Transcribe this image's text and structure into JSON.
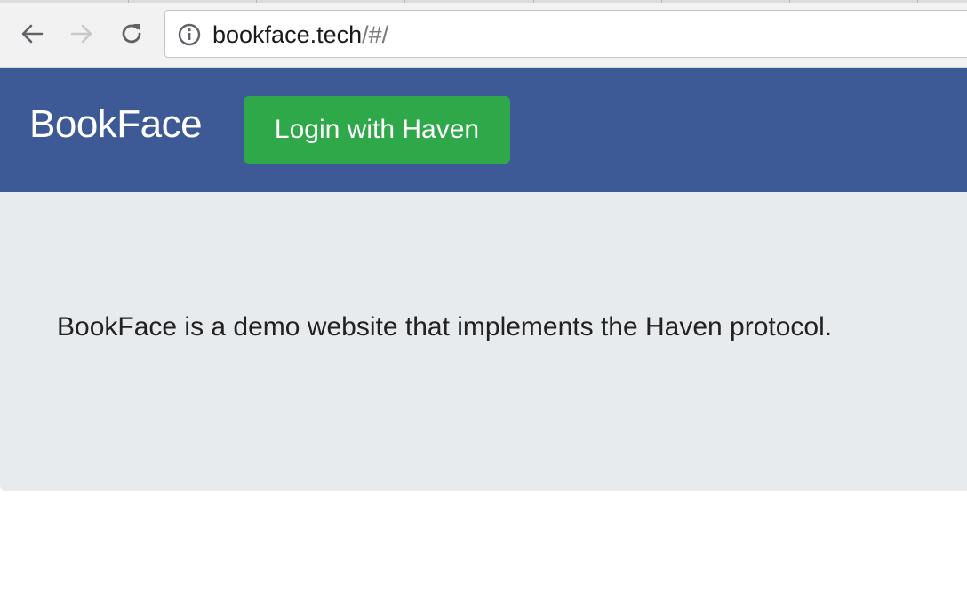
{
  "browser": {
    "url_host": "bookface.tech",
    "url_path": "/#/",
    "back_icon": "arrow-left-icon",
    "forward_icon": "arrow-right-icon",
    "reload_icon": "reload-icon",
    "info_icon": "info-icon"
  },
  "header": {
    "brand": "BookFace",
    "login_label": "Login with Haven",
    "background_color": "#3d5a96",
    "button_color": "#2fa84a"
  },
  "main": {
    "lead_text": "BookFace is a demo website that implements the Haven protocol.",
    "background_color": "#e8ebee"
  }
}
